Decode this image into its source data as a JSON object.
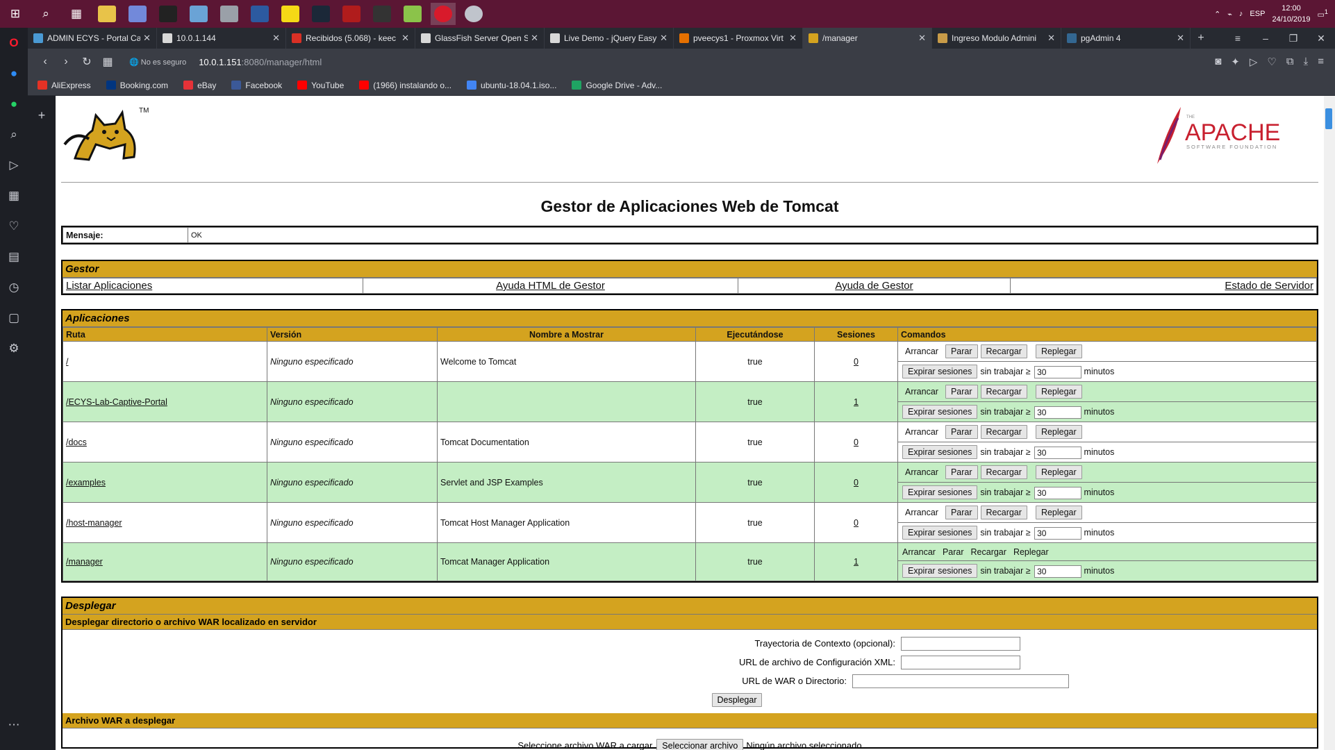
{
  "taskbar": {
    "clock_time": "12:00",
    "clock_date": "24/10/2019",
    "lang": "ESP",
    "notif_count": "1"
  },
  "tabs": [
    {
      "title": "ADMIN ECYS - Portal Ca",
      "favicon": "#4a9ad4"
    },
    {
      "title": "10.0.1.144",
      "favicon": "#d8d8d8"
    },
    {
      "title": "Recibidos (5.068) - keec",
      "favicon": "#d93025"
    },
    {
      "title": "GlassFish Server Open S",
      "favicon": "#d8d8d8"
    },
    {
      "title": "Live Demo - jQuery Easy",
      "favicon": "#d8d8d8"
    },
    {
      "title": "pveecys1 - Proxmox Virt",
      "favicon": "#e57000"
    },
    {
      "title": "/manager",
      "favicon": "#d4a31f",
      "active": true
    },
    {
      "title": "Ingreso Modulo Admini",
      "favicon": "#c89b48"
    },
    {
      "title": "pgAdmin 4",
      "favicon": "#336791"
    }
  ],
  "address": {
    "security": "No es seguro",
    "host": "10.0.1.151",
    "path": ":8080/manager/html"
  },
  "bookmarks": [
    {
      "label": "AliExpress",
      "color": "#e43225"
    },
    {
      "label": "Booking.com",
      "color": "#003580"
    },
    {
      "label": "eBay",
      "color": "#e53238"
    },
    {
      "label": "Facebook",
      "color": "#3b5998"
    },
    {
      "label": "YouTube",
      "color": "#ff0000"
    },
    {
      "label": "(1966) instalando o...",
      "color": "#ff0000"
    },
    {
      "label": "ubuntu-18.04.1.iso...",
      "color": "#4285f4"
    },
    {
      "label": "Google Drive - Adv...",
      "color": "#1fa463"
    }
  ],
  "page": {
    "title": "Gestor de Aplicaciones Web de Tomcat",
    "message_label": "Mensaje:",
    "message_value": "OK"
  },
  "gestor": {
    "title": "Gestor",
    "links": [
      "Listar Aplicaciones",
      "Ayuda HTML de Gestor",
      "Ayuda de Gestor",
      "Estado de Servidor"
    ]
  },
  "apps": {
    "title": "Aplicaciones",
    "headers": [
      "Ruta",
      "Versión",
      "Nombre a Mostrar",
      "Ejecutándose",
      "Sesiones",
      "Comandos"
    ],
    "cmd_labels": {
      "start": "Arrancar",
      "stop": "Parar",
      "reload": "Recargar",
      "undeploy": "Replegar",
      "expire": "Expirar sesiones",
      "idle": "sin trabajar ≥",
      "minutes": "minutos",
      "idle_value": "30"
    },
    "rows": [
      {
        "path": "/",
        "version": "Ninguno especificado",
        "name": "Welcome to Tomcat",
        "running": "true",
        "sessions": "0"
      },
      {
        "path": "/ECYS-Lab-Captive-Portal",
        "version": "Ninguno especificado",
        "name": "",
        "running": "true",
        "sessions": "1"
      },
      {
        "path": "/docs",
        "version": "Ninguno especificado",
        "name": "Tomcat Documentation",
        "running": "true",
        "sessions": "0"
      },
      {
        "path": "/examples",
        "version": "Ninguno especificado",
        "name": "Servlet and JSP Examples",
        "running": "true",
        "sessions": "0"
      },
      {
        "path": "/host-manager",
        "version": "Ninguno especificado",
        "name": "Tomcat Host Manager Application",
        "running": "true",
        "sessions": "0"
      },
      {
        "path": "/manager",
        "version": "Ninguno especificado",
        "name": "Tomcat Manager Application",
        "running": "true",
        "sessions": "1"
      }
    ]
  },
  "deploy": {
    "title": "Desplegar",
    "server_sub": "Desplegar directorio o archivo WAR localizado en servidor",
    "context_label": "Trayectoria de Contexto (opcional):",
    "xml_label": "URL de archivo de Configuración XML:",
    "war_label": "URL de WAR o Directorio:",
    "deploy_btn": "Desplegar",
    "war_sub": "Archivo WAR a desplegar",
    "file_label": "Seleccione archivo WAR a cargar",
    "file_btn": "Seleccionar archivo",
    "file_none": "Ningún archivo seleccionado"
  }
}
